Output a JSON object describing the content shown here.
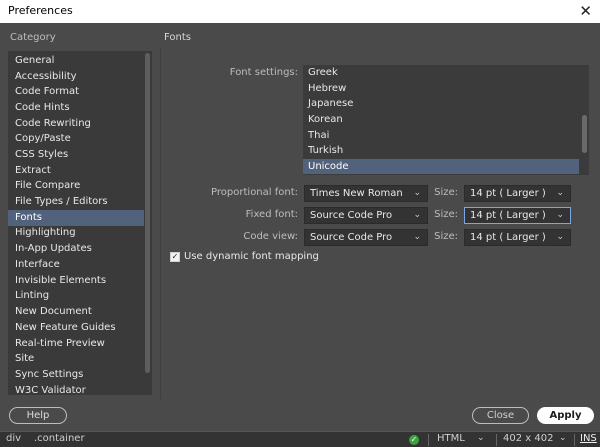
{
  "window": {
    "title": "Preferences",
    "close_glyph": "✕"
  },
  "category_header": "Category",
  "section_title": "Fonts",
  "categories": [
    "General",
    "Accessibility",
    "Code Format",
    "Code Hints",
    "Code Rewriting",
    "Copy/Paste",
    "CSS Styles",
    "Extract",
    "File Compare",
    "File Types / Editors",
    "Fonts",
    "Highlighting",
    "In-App Updates",
    "Interface",
    "Invisible Elements",
    "Linting",
    "New Document",
    "New Feature Guides",
    "Real-time Preview",
    "Site",
    "Sync Settings",
    "W3C Validator"
  ],
  "selected_category": "Fonts",
  "font_settings": {
    "label": "Font settings:",
    "items": [
      "Greek",
      "Hebrew",
      "Japanese",
      "Korean",
      "Thai",
      "Turkish",
      "Unicode"
    ],
    "selected": "Unicode"
  },
  "rows": [
    {
      "label": "Proportional font:",
      "font": "Times New Roman",
      "size_label": "Size:",
      "size": "14 pt ( Larger )"
    },
    {
      "label": "Fixed font:",
      "font": "Source Code Pro",
      "size_label": "Size:",
      "size": "14 pt ( Larger )"
    },
    {
      "label": "Code view:",
      "font": "Source Code Pro",
      "size_label": "Size:",
      "size": "14 pt ( Larger )"
    }
  ],
  "dynamic_mapping": {
    "label": "Use dynamic font mapping",
    "checked": true
  },
  "buttons": {
    "help": "Help",
    "close": "Close",
    "apply": "Apply"
  },
  "statusbar": {
    "tag": "div",
    "selector": ".container",
    "doc_type": "HTML",
    "dimensions": "402 x 402",
    "mode": "INS"
  },
  "icons": {
    "chevron": "chevron-down-icon",
    "check": "checkmark-icon",
    "status_ok": "check-circle-icon"
  },
  "colors": {
    "selection": "#53627c",
    "focus_border": "#7aa6e6",
    "status_ok": "#3aa53a"
  }
}
